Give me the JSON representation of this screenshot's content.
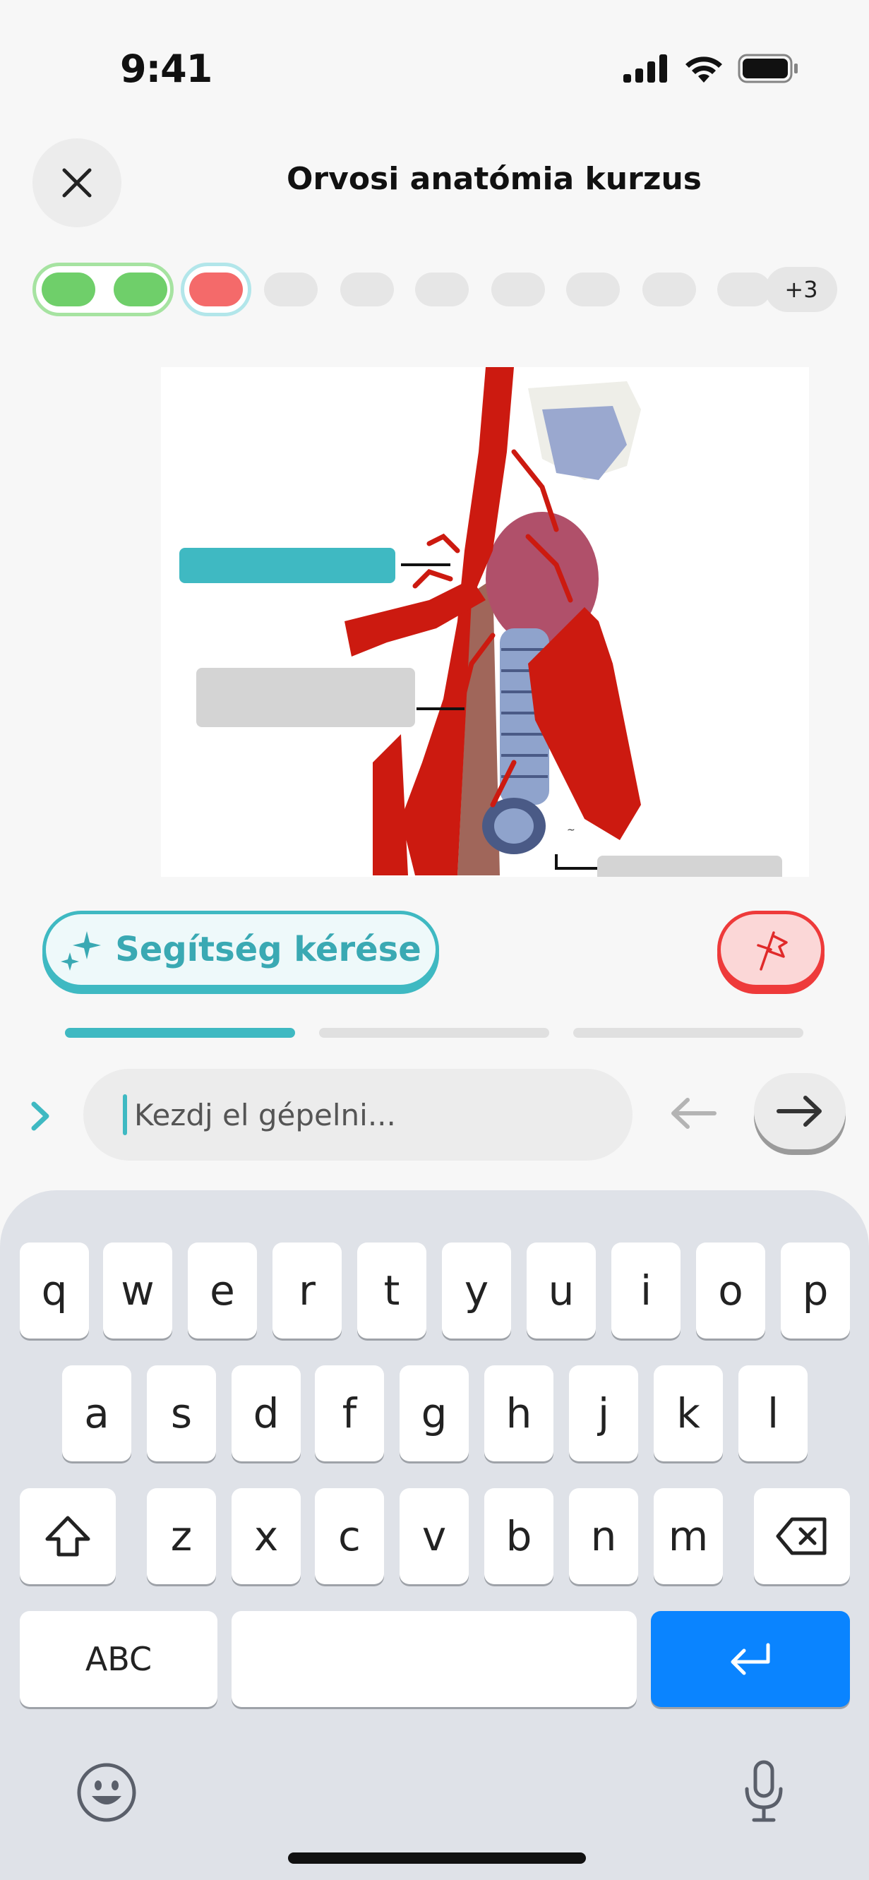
{
  "status_bar": {
    "time": "9:41"
  },
  "header": {
    "title": "Orvosi anatómia kurzus"
  },
  "progress": {
    "more_label": "+3",
    "colors": {
      "correct": "#6fcf6a",
      "wrong": "#f46a6a",
      "pending": "#e6e6e6",
      "accent": "#3fb9c2"
    }
  },
  "actions": {
    "help_label": "Segítség kérése"
  },
  "input": {
    "placeholder": "Kezdj el gépelni..."
  },
  "keyboard": {
    "row1": [
      "q",
      "w",
      "e",
      "r",
      "t",
      "y",
      "u",
      "i",
      "o",
      "p"
    ],
    "row2": [
      "a",
      "s",
      "d",
      "f",
      "g",
      "h",
      "j",
      "k",
      "l"
    ],
    "row3": [
      "z",
      "x",
      "c",
      "v",
      "b",
      "n",
      "m"
    ],
    "abc_label": "ABC"
  }
}
